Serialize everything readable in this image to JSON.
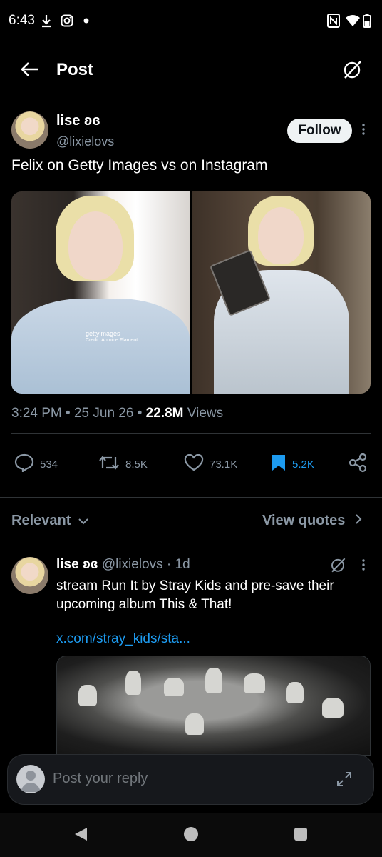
{
  "status_bar": {
    "time": "6:43",
    "icons_left": [
      "download-icon",
      "instagram-icon",
      "dot-icon"
    ],
    "icons_right": [
      "nfc-icon",
      "wifi-icon",
      "battery-icon"
    ]
  },
  "header": {
    "back_icon": "arrow-left-icon",
    "title": "Post",
    "grok_icon": "grok-icon"
  },
  "post": {
    "author_name": "lise ʚɞ",
    "author_handle": "@lixielovs",
    "follow_label": "Follow",
    "text": "Felix on Getty Images vs on Instagram",
    "watermark_brand": "gettyimages",
    "watermark_credit": "Credit: Antoine Flament",
    "time": "3:24 PM",
    "date": "25 Jun 26",
    "views_count": "22.8M",
    "views_label": "Views",
    "actions": {
      "replies": "534",
      "reposts": "8.5K",
      "likes": "73.1K",
      "bookmarks": "5.2K"
    }
  },
  "replies_section": {
    "sort_label": "Relevant",
    "view_quotes_label": "View quotes"
  },
  "reply": {
    "author_name": "lise ʚɞ",
    "author_handle": "@lixielovs",
    "age": "1d",
    "text": "stream Run It by Stray Kids and pre-save their upcoming album This & That!",
    "link": "x.com/stray_kids/sta..."
  },
  "composer": {
    "placeholder": "Post your reply"
  },
  "colors": {
    "background": "#000000",
    "accent": "#1d9bf0",
    "muted": "#8b98a5",
    "divider": "#2f3336"
  }
}
